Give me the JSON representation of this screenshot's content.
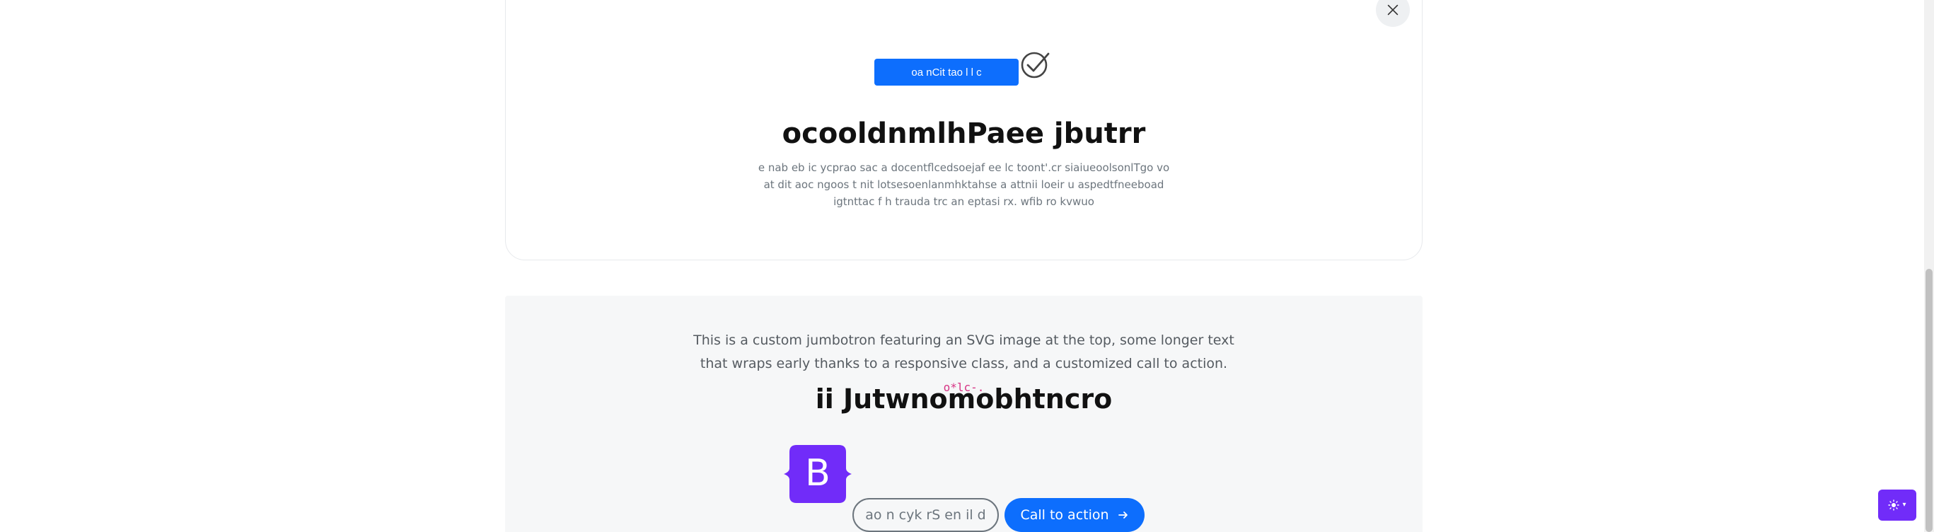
{
  "modal": {
    "badge_button_label": "oa nCit tao l l c",
    "title": "ocooldnmlhPaee jbutrr",
    "text": "e nab eb ic ycprao sac a docentflcedsoejaf ee lc toont'.cr siaiueoolsonlTgo vo at dit aoc ngoos t nit lotsesoenlanmhktahse a attnii loeir u aspedtfneeboad igtnttac f h trauda trc an eptasi rx. wfib ro kvwuo",
    "close_icon": "close-icon",
    "check_icon": "check-circle-icon"
  },
  "jumbotron": {
    "lead": "This is a custom jumbotron featuring an SVG image at the top, some longer text that wraps early thanks to a responsive class, and a customized call to action.",
    "code": "o*lc-.",
    "title": "ii Jutwnomobhtncro",
    "logo_letter": "B",
    "secondary_button_label": "ao n cyk rS en il d",
    "primary_button_label": "Call to action",
    "arrow_icon": "arrow-right-icon"
  },
  "theme_toggle": {
    "icon": "sun-icon",
    "caret": "▾"
  },
  "colors": {
    "primary": "#0d6efd",
    "brand_purple": "#712cf9",
    "code_pink": "#d63384",
    "muted": "#6c757d"
  }
}
